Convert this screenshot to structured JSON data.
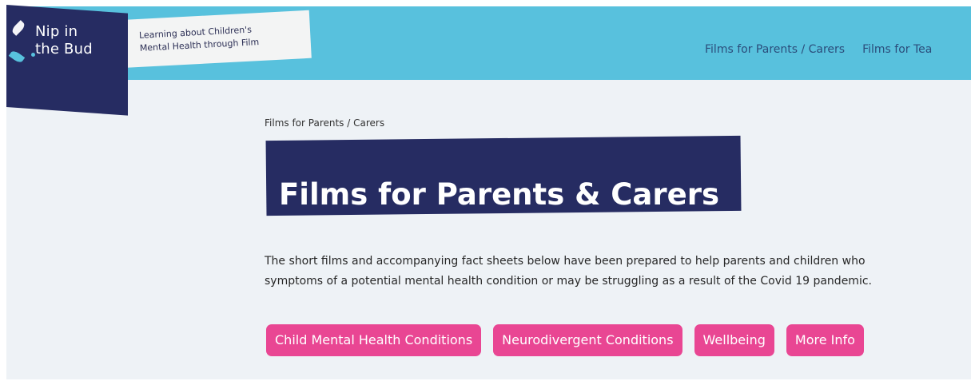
{
  "logo": {
    "name": "Nip in\nthe Bud"
  },
  "header": {
    "tagline": "Learning about Children's\nMental Health through Film",
    "nav": [
      "Films for Parents / Carers",
      "Films for Tea"
    ]
  },
  "main": {
    "breadcrumb": "Films for Parents / Carers",
    "title": "Films for Parents & Carers",
    "description": "The short films and accompanying fact sheets below have been prepared to help parents and children who\nsymptoms of a potential mental health condition or may be struggling as a result of the Covid 19 pandemic.",
    "buttons": [
      "Child Mental Health Conditions",
      "Neurodivergent Conditions",
      "Wellbeing",
      "More Info"
    ]
  },
  "colors": {
    "header": "#58c1dd",
    "brand_navy": "#262c62",
    "button_pink": "#e94693",
    "background": "#eef2f6"
  }
}
